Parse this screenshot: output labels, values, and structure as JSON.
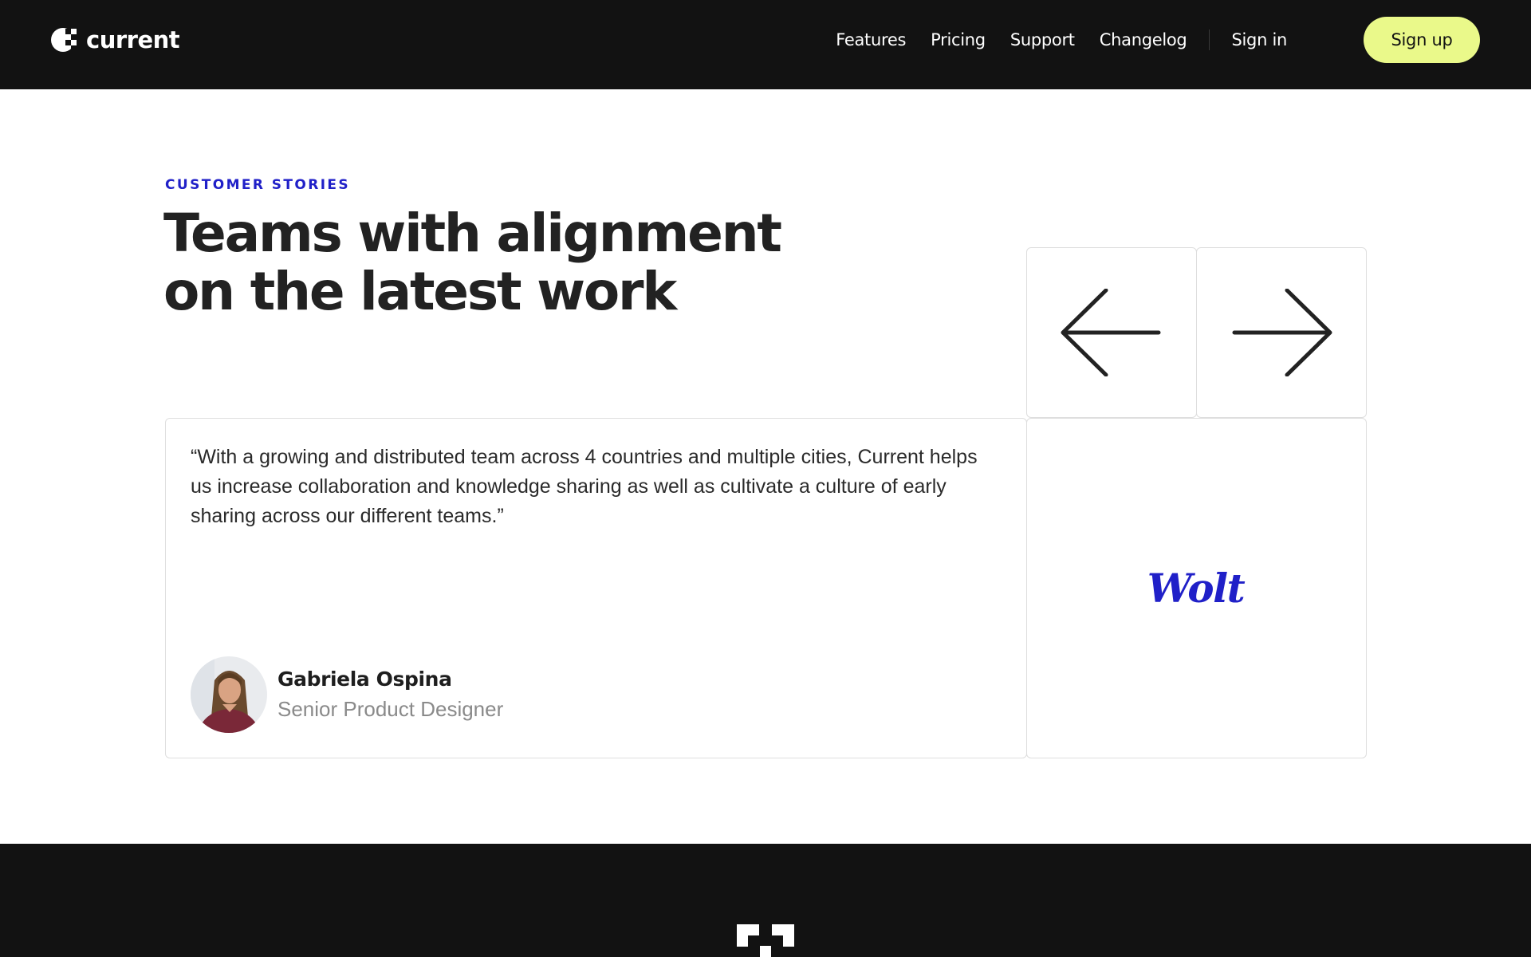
{
  "header": {
    "brand": {
      "name": "current",
      "logo_icon": "current-logo-icon"
    },
    "nav": [
      {
        "label": "Features"
      },
      {
        "label": "Pricing"
      },
      {
        "label": "Support"
      },
      {
        "label": "Changelog"
      }
    ],
    "sign_in": "Sign in",
    "sign_up": "Sign up"
  },
  "section": {
    "eyebrow": "CUSTOMER STORIES",
    "title_line1": "Teams with alignment",
    "title_line2": "on the latest work"
  },
  "carousel": {
    "prev_icon": "arrow-left-icon",
    "next_icon": "arrow-right-icon"
  },
  "testimonial": {
    "quote": "“With a growing and distributed team across 4 countries and multiple cities, Current helps us increase collaboration and knowledge sharing as well as cultivate a culture of early sharing across our different teams.”",
    "author_name": "Gabriela Ospina",
    "author_role": "Senior Product Designer",
    "company": "Wolt"
  },
  "footer": {
    "logo_icon": "current-footer-mark-icon"
  },
  "colors": {
    "dark": "#121212",
    "accent_lime": "#eaf98a",
    "brand_blue": "#2020c8",
    "card_border": "#dedede"
  }
}
